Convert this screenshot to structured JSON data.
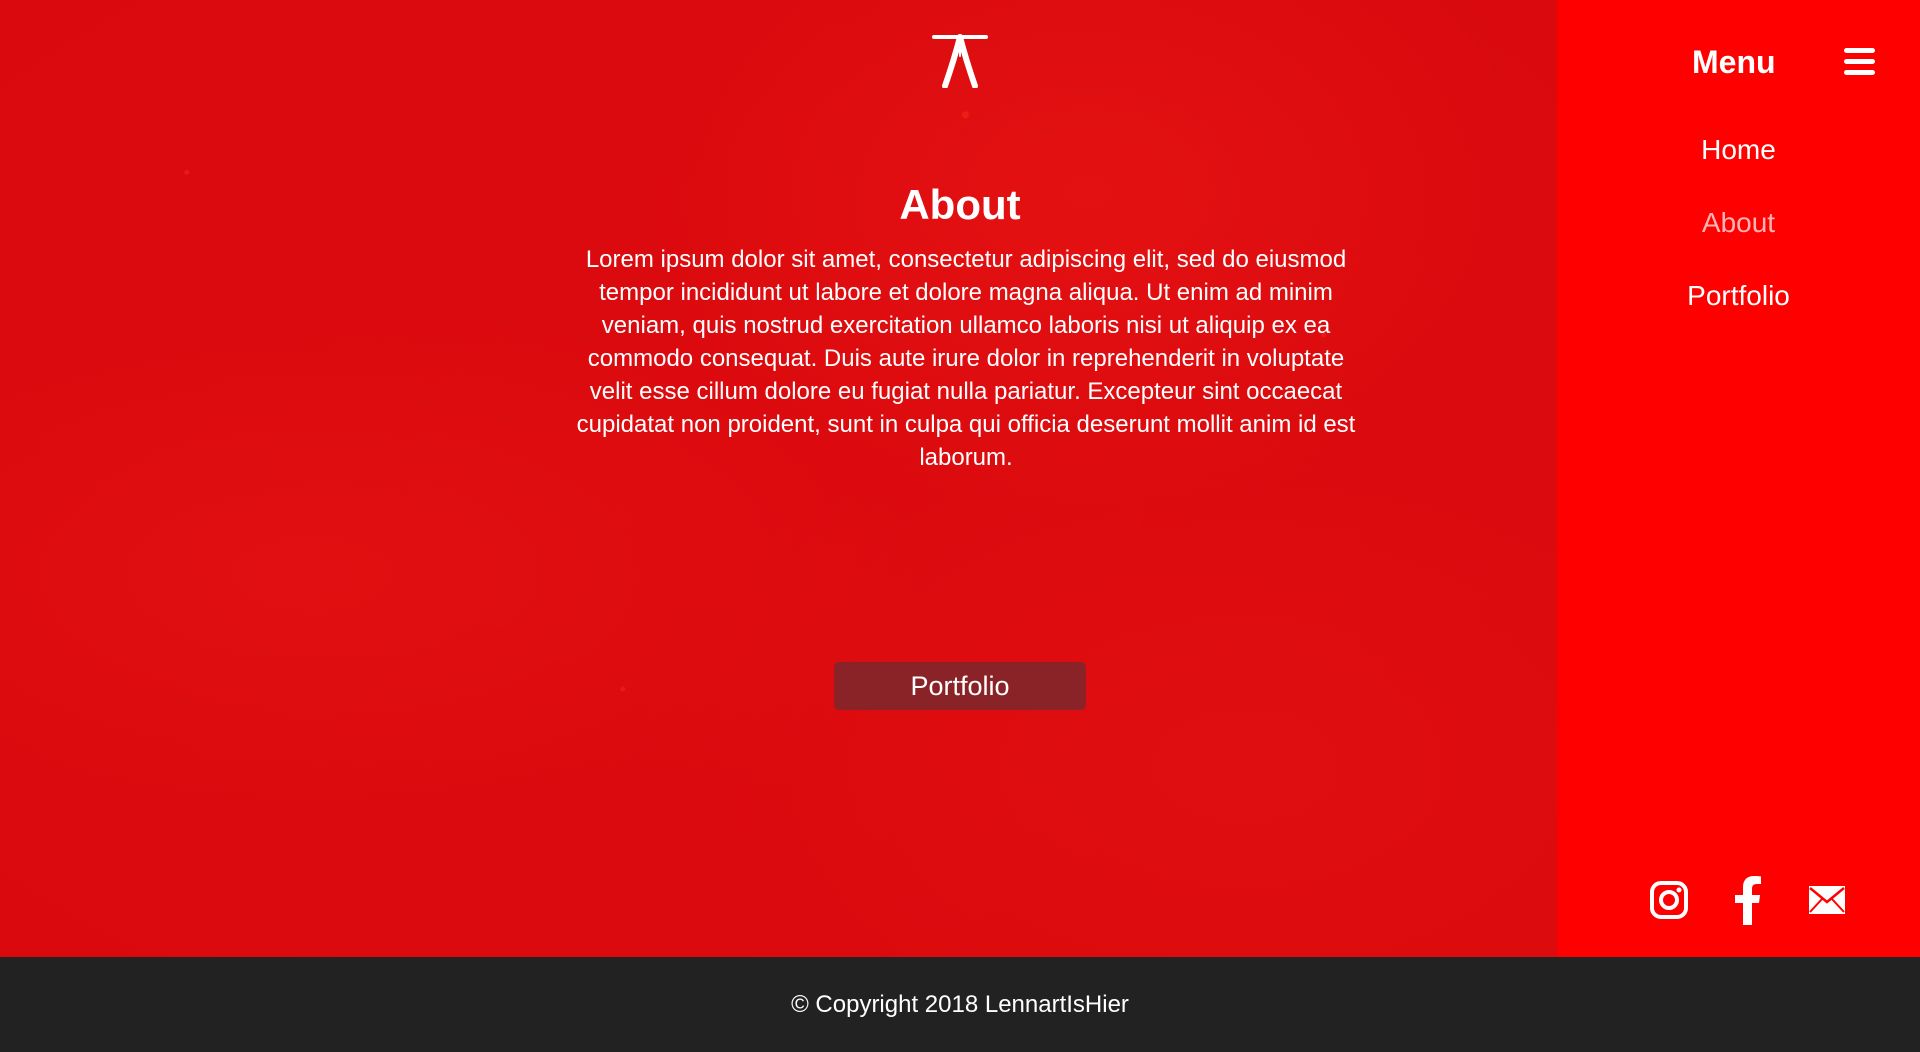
{
  "colors": {
    "main_background": "#dc0a0e",
    "sidebar_background": "#ff0000",
    "footer_background": "#222222",
    "button_background": "#8a2328",
    "text": "#ffffff",
    "active_nav_text": "#ffb3b3"
  },
  "header": {
    "logo_icon": "tripod-logo-icon"
  },
  "about": {
    "title": "About",
    "text": "Lorem ipsum dolor sit amet, consectetur adipiscing elit, sed do eiusmod tempor incididunt ut labore et dolore magna aliqua. Ut enim ad minim veniam, quis nostrud exercitation ullamco laboris nisi ut aliquip ex ea commodo consequat. Duis aute irure dolor in reprehenderit in voluptate velit esse cillum dolore eu fugiat nulla pariatur. Excepteur sint occaecat cupidatat non proident, sunt in culpa qui officia deserunt mollit anim id est laborum.",
    "button_label": "Portfolio"
  },
  "sidebar": {
    "menu_title": "Menu",
    "menu_icon": "hamburger-icon",
    "items": [
      {
        "label": "Home",
        "active": false
      },
      {
        "label": "About",
        "active": true
      },
      {
        "label": "Portfolio",
        "active": false
      }
    ],
    "social_icons": [
      "instagram-icon",
      "facebook-icon",
      "mail-icon"
    ]
  },
  "footer": {
    "copyright": "© Copyright 2018 LennartIsHier"
  }
}
